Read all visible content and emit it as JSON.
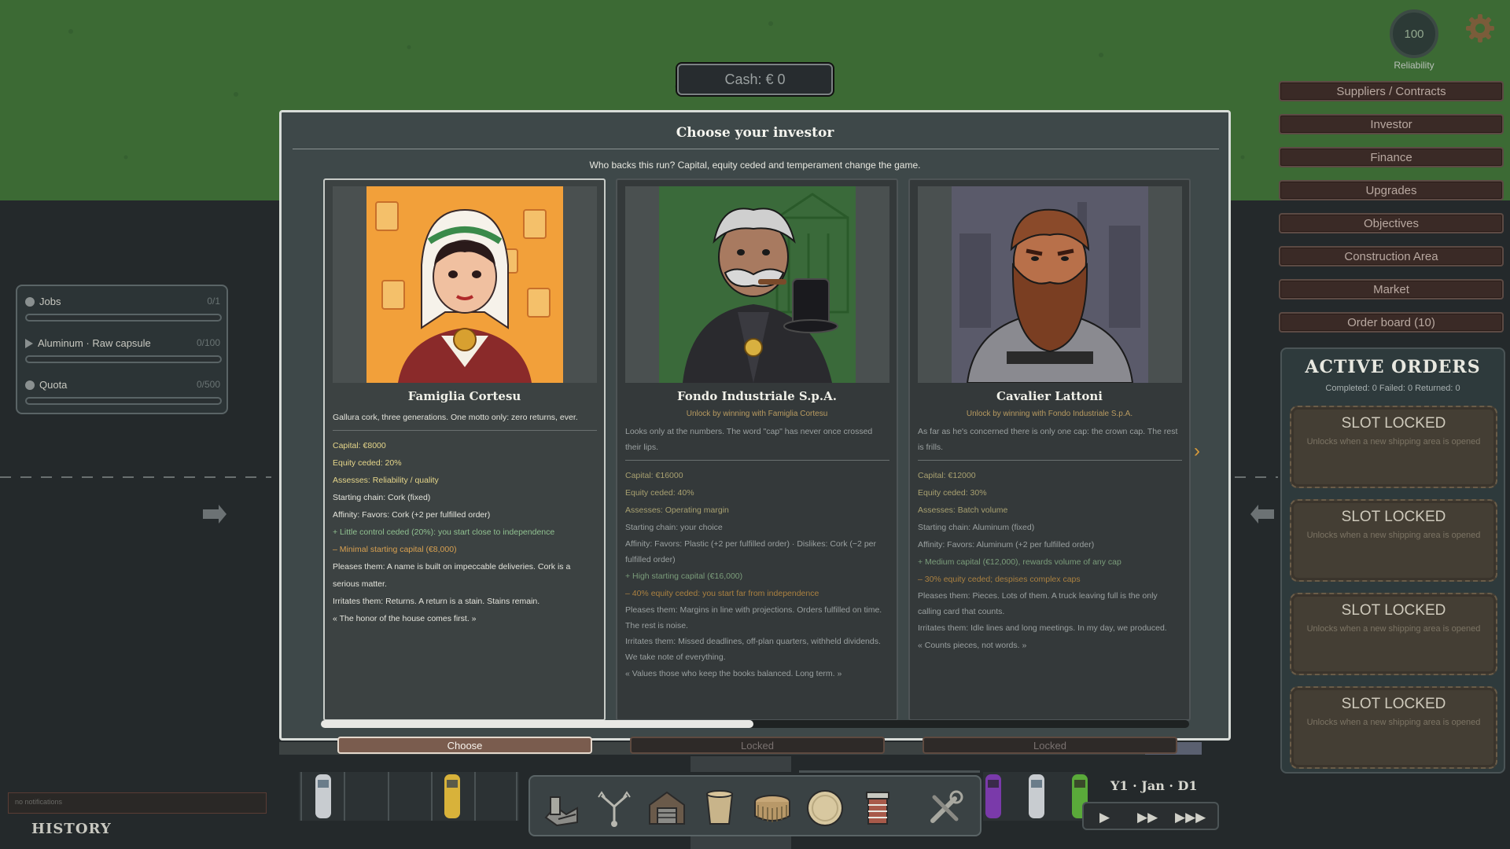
{
  "hud": {
    "cash": "Cash: € 0",
    "reliability_value": "100",
    "reliability_label": "Reliability"
  },
  "menu": [
    "Suppliers / Contracts",
    "Investor",
    "Finance",
    "Upgrades",
    "Objectives",
    "Construction Area",
    "Market",
    "Order board (10)"
  ],
  "active_orders": {
    "title": "ACTIVE ORDERS",
    "stats": "Completed: 0   Failed: 0   Returned: 0",
    "slots": [
      {
        "title": "SLOT LOCKED",
        "subtitle": "Unlocks when a new shipping area is opened"
      },
      {
        "title": "SLOT LOCKED",
        "subtitle": "Unlocks when a new shipping area is opened"
      },
      {
        "title": "SLOT LOCKED",
        "subtitle": "Unlocks when a new shipping area is opened"
      },
      {
        "title": "SLOT LOCKED",
        "subtitle": "Unlocks when a new shipping area is opened"
      }
    ]
  },
  "jobs_panel": {
    "rows": [
      {
        "label": "Jobs",
        "value": "0/1",
        "icon": "dot"
      },
      {
        "label": "Aluminum · Raw capsule",
        "value": "0/100",
        "icon": "triangle"
      },
      {
        "label": "Quota",
        "value": "0/500",
        "icon": "dot"
      }
    ]
  },
  "notifications": "no notifications",
  "history": "HISTORY",
  "date": "Y1 · Jan · D1",
  "modal": {
    "title": "Choose your investor",
    "subtitle": "Who backs this run? Capital, equity ceded and temperament change the game.",
    "cards": [
      {
        "name": "Famiglia Cortesu",
        "unlock": "",
        "desc": "Gallura cork, three generations. One motto only: zero returns, ever.",
        "capital": "Capital: €8000",
        "equity": "Equity ceded: 20%",
        "assesses": "Assesses: Reliability / quality",
        "chain": "Starting chain: Cork (fixed)",
        "affinity": "Affinity: Favors: Cork (+2 per fulfilled order)",
        "pros": "+ Little control ceded (20%): you start close to independence",
        "cons": "– Minimal starting capital (€8,000)",
        "pleases": "Pleases them: A name is built on impeccable deliveries. Cork is a serious matter.",
        "irritates": "Irritates them: Returns. A return is a stain. Stains remain.",
        "quote": "« The honor of the house comes first. »",
        "button": "Choose"
      },
      {
        "name": "Fondo Industriale S.p.A.",
        "unlock": "Unlock by winning with Famiglia Cortesu",
        "desc": "Looks only at the numbers. The word \"cap\" has never once crossed their lips.",
        "capital": "Capital: €16000",
        "equity": "Equity ceded: 40%",
        "assesses": "Assesses: Operating margin",
        "chain": "Starting chain: your choice",
        "affinity": "Affinity: Favors: Plastic (+2 per fulfilled order)  ·  Dislikes: Cork (−2 per fulfilled order)",
        "pros": "+ High starting capital (€16,000)",
        "cons": "– 40% equity ceded: you start far from independence",
        "pleases": "Pleases them: Margins in line with projections. Orders fulfilled on time. The rest is noise.",
        "irritates": "Irritates them: Missed deadlines, off-plan quarters, withheld dividends. We take note of everything.",
        "quote": "« Values those who keep the books balanced. Long term. »",
        "button": "Locked"
      },
      {
        "name": "Cavalier Lattoni",
        "unlock": "Unlock by winning with Fondo Industriale S.p.A.",
        "desc": "As far as he's concerned there is only one cap: the crown cap. The rest is frills.",
        "capital": "Capital: €12000",
        "equity": "Equity ceded: 30%",
        "assesses": "Assesses: Batch volume",
        "chain": "Starting chain: Aluminum (fixed)",
        "affinity": "Affinity: Favors: Aluminum (+2 per fulfilled order)",
        "pros": "+ Medium capital (€12,000), rewards volume of any cap",
        "cons": "– 30% equity ceded; despises complex caps",
        "pleases": "Pleases them: Pieces. Lots of them. A truck leaving full is the only calling card that counts.",
        "irritates": "Irritates them: Idle lines and long meetings. In my day, we produced.",
        "quote": "« Counts pieces, not words. »",
        "button": "Locked"
      }
    ]
  },
  "toolbar": [
    "factory-icon",
    "splitter-icon",
    "warehouse-icon",
    "cork-icon",
    "crown-cap-icon",
    "disc-cap-icon",
    "pillar-icon",
    "tools-icon"
  ]
}
